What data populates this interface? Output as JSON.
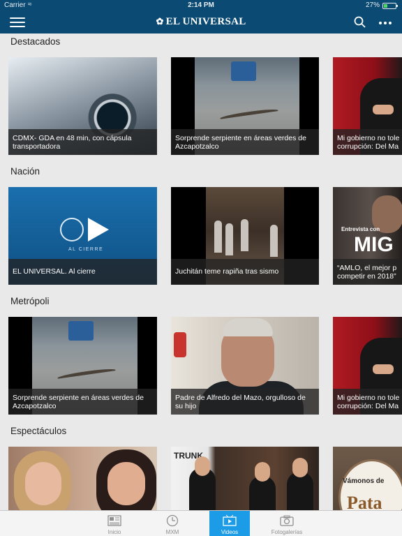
{
  "status_bar": {
    "carrier": "Carrier",
    "time": "2:14 PM",
    "battery_text": "27%",
    "battery_level": 0.27
  },
  "navbar": {
    "brand": "EL UNIVERSAL"
  },
  "sections": [
    {
      "title": "Destacados",
      "cards": [
        {
          "line1": "CDMX- GDA en 48 min, con cápsula",
          "line2": "transportadora"
        },
        {
          "line1": "Sorprende serpiente en áreas verdes de",
          "line2": "Azcapotzalco"
        },
        {
          "line1": "Mi gobierno no tole",
          "line2": "corrupción: Del Ma"
        }
      ]
    },
    {
      "title": "Nación",
      "cards": [
        {
          "line1": "EL UNIVERSAL. Al cierre",
          "line2": ""
        },
        {
          "line1": "Juchitán teme rapiña tras sismo",
          "line2": ""
        },
        {
          "line1": "“AMLO, el mejor p",
          "line2": "competir en 2018”"
        }
      ]
    },
    {
      "title": "Metrópoli",
      "cards": [
        {
          "line1": "Sorprende serpiente en áreas verdes de",
          "line2": "Azcapotzalco"
        },
        {
          "line1": "Padre de Alfredo del Mazo, orgulloso de",
          "line2": "su hijo"
        },
        {
          "line1": "Mi gobierno no tole",
          "line2": "corrupción: Del Ma"
        }
      ]
    },
    {
      "title": "Espectáculos",
      "cards": [
        {
          "line1": "",
          "line2": ""
        },
        {
          "line1": "",
          "line2": ""
        },
        {
          "line1": "",
          "line2": ""
        }
      ]
    }
  ],
  "thumb_text": {
    "al_cierre": "AL CIERRE",
    "entrevista": "Entrevista con",
    "entrevista_big": "MIG",
    "trunk": "TRUNK",
    "vamonos": "Vámonos de",
    "pata": "Pata"
  },
  "tabs": [
    {
      "label": "Inicio",
      "icon": "newspaper-icon"
    },
    {
      "label": "MXM",
      "icon": "clock-icon"
    },
    {
      "label": "Videos",
      "icon": "video-icon"
    },
    {
      "label": "Fotogalerías",
      "icon": "camera-icon"
    }
  ],
  "active_tab": "Videos",
  "colors": {
    "navbar": "#0b4b73",
    "active_tab": "#1c9be6",
    "background": "#e9e9e9"
  }
}
